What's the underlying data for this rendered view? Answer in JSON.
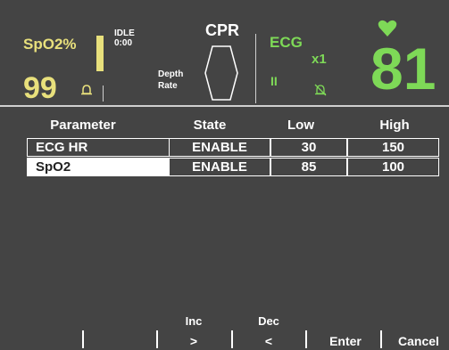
{
  "spo2": {
    "label": "SpO2%",
    "value": "99",
    "bar_level": 0.5,
    "bell_icon": "bell-icon",
    "color": "#e8e07c"
  },
  "status": {
    "mode": "IDLE",
    "time": "0:00"
  },
  "cpr": {
    "title": "CPR",
    "depth_label": "Depth",
    "rate_label": "Rate"
  },
  "ecg": {
    "label": "ECG",
    "gain": "x1",
    "lead": "II",
    "hr_value": "81",
    "color": "#7ed957",
    "alarm_icon": "alarm-off-icon",
    "heart_icon": "heart-icon"
  },
  "table": {
    "headers": [
      "Parameter",
      "State",
      "Low",
      "High"
    ],
    "rows": [
      {
        "name": "ECG HR",
        "state": "ENABLE",
        "low": "30",
        "high": "150"
      },
      {
        "name": "SpO2",
        "state": "ENABLE",
        "low": "85",
        "high": "100"
      }
    ]
  },
  "softkeys": {
    "inc_top": "Inc",
    "inc": ">",
    "dec_top": "Dec",
    "dec": "<",
    "enter": "Enter",
    "cancel": "Cancel"
  }
}
